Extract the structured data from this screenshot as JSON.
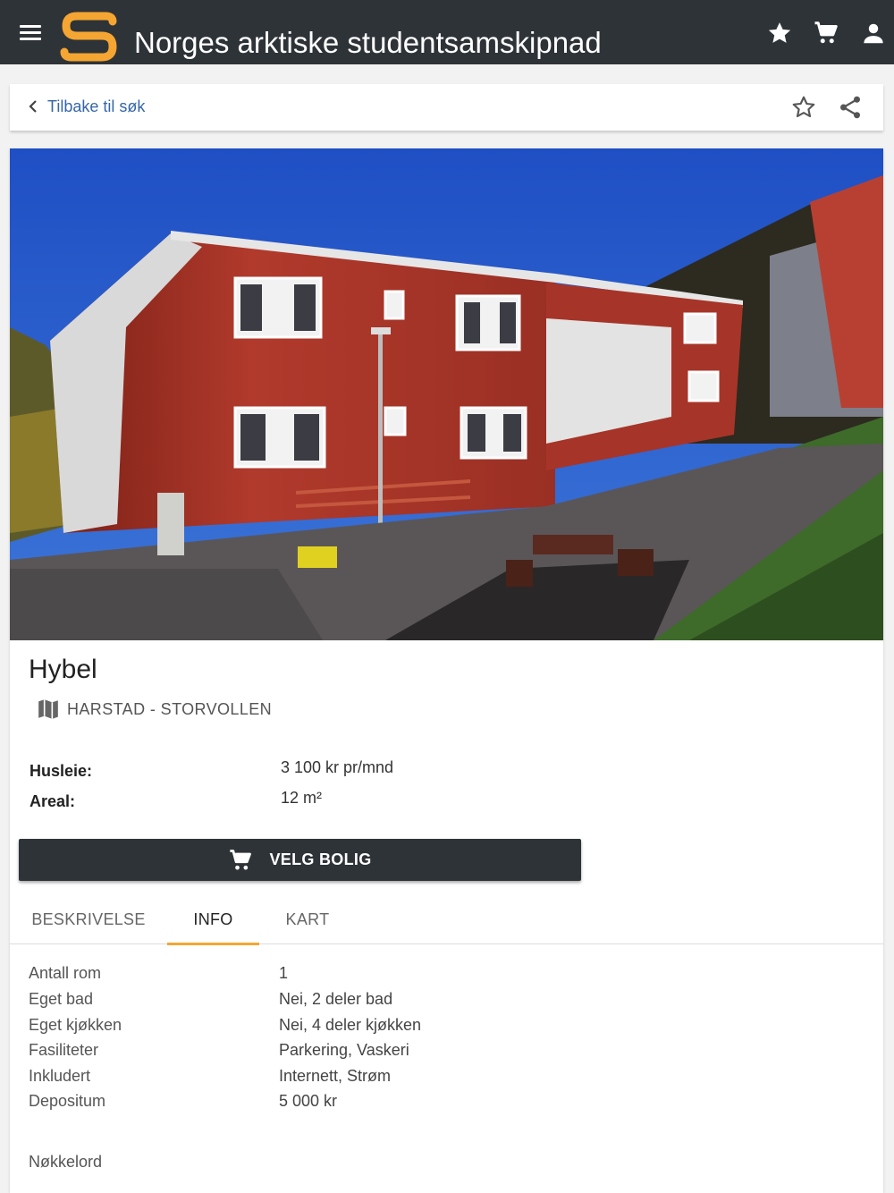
{
  "header": {
    "site_title": "Norges arktiske studentsamskipnad",
    "icons": [
      "menu-icon",
      "star-icon",
      "cart-icon",
      "person-icon"
    ],
    "brand_color": "#f5a531",
    "bar_color": "#2e3338"
  },
  "nav": {
    "back_label": "Tilbake til søk",
    "icons": [
      "chevron-left-icon",
      "star-outline-icon",
      "share-icon"
    ]
  },
  "listing": {
    "title": "Hybel",
    "location": "HARSTAD - STORVOLLEN",
    "rent_label": "Husleie:",
    "rent_value": "3 100 kr pr/mnd",
    "area_label": "Areal:",
    "area_value": "12 m²",
    "cta_label": "VELG BOLIG"
  },
  "tabs": [
    {
      "label": "BESKRIVELSE",
      "active": false
    },
    {
      "label": "INFO",
      "active": true
    },
    {
      "label": "KART",
      "active": false
    }
  ],
  "info": [
    {
      "label": "Antall rom",
      "value": "1"
    },
    {
      "label": "Eget bad",
      "value": "Nei, 2 deler bad"
    },
    {
      "label": "Eget kjøkken",
      "value": "Nei, 4 deler kjøkken"
    },
    {
      "label": "Fasiliteter",
      "value": "Parkering, Vaskeri"
    },
    {
      "label": "Inkludert",
      "value": "Internett, Strøm"
    },
    {
      "label": "Depositum",
      "value": "5 000 kr"
    }
  ],
  "keywords_label": "Nøkkelord"
}
